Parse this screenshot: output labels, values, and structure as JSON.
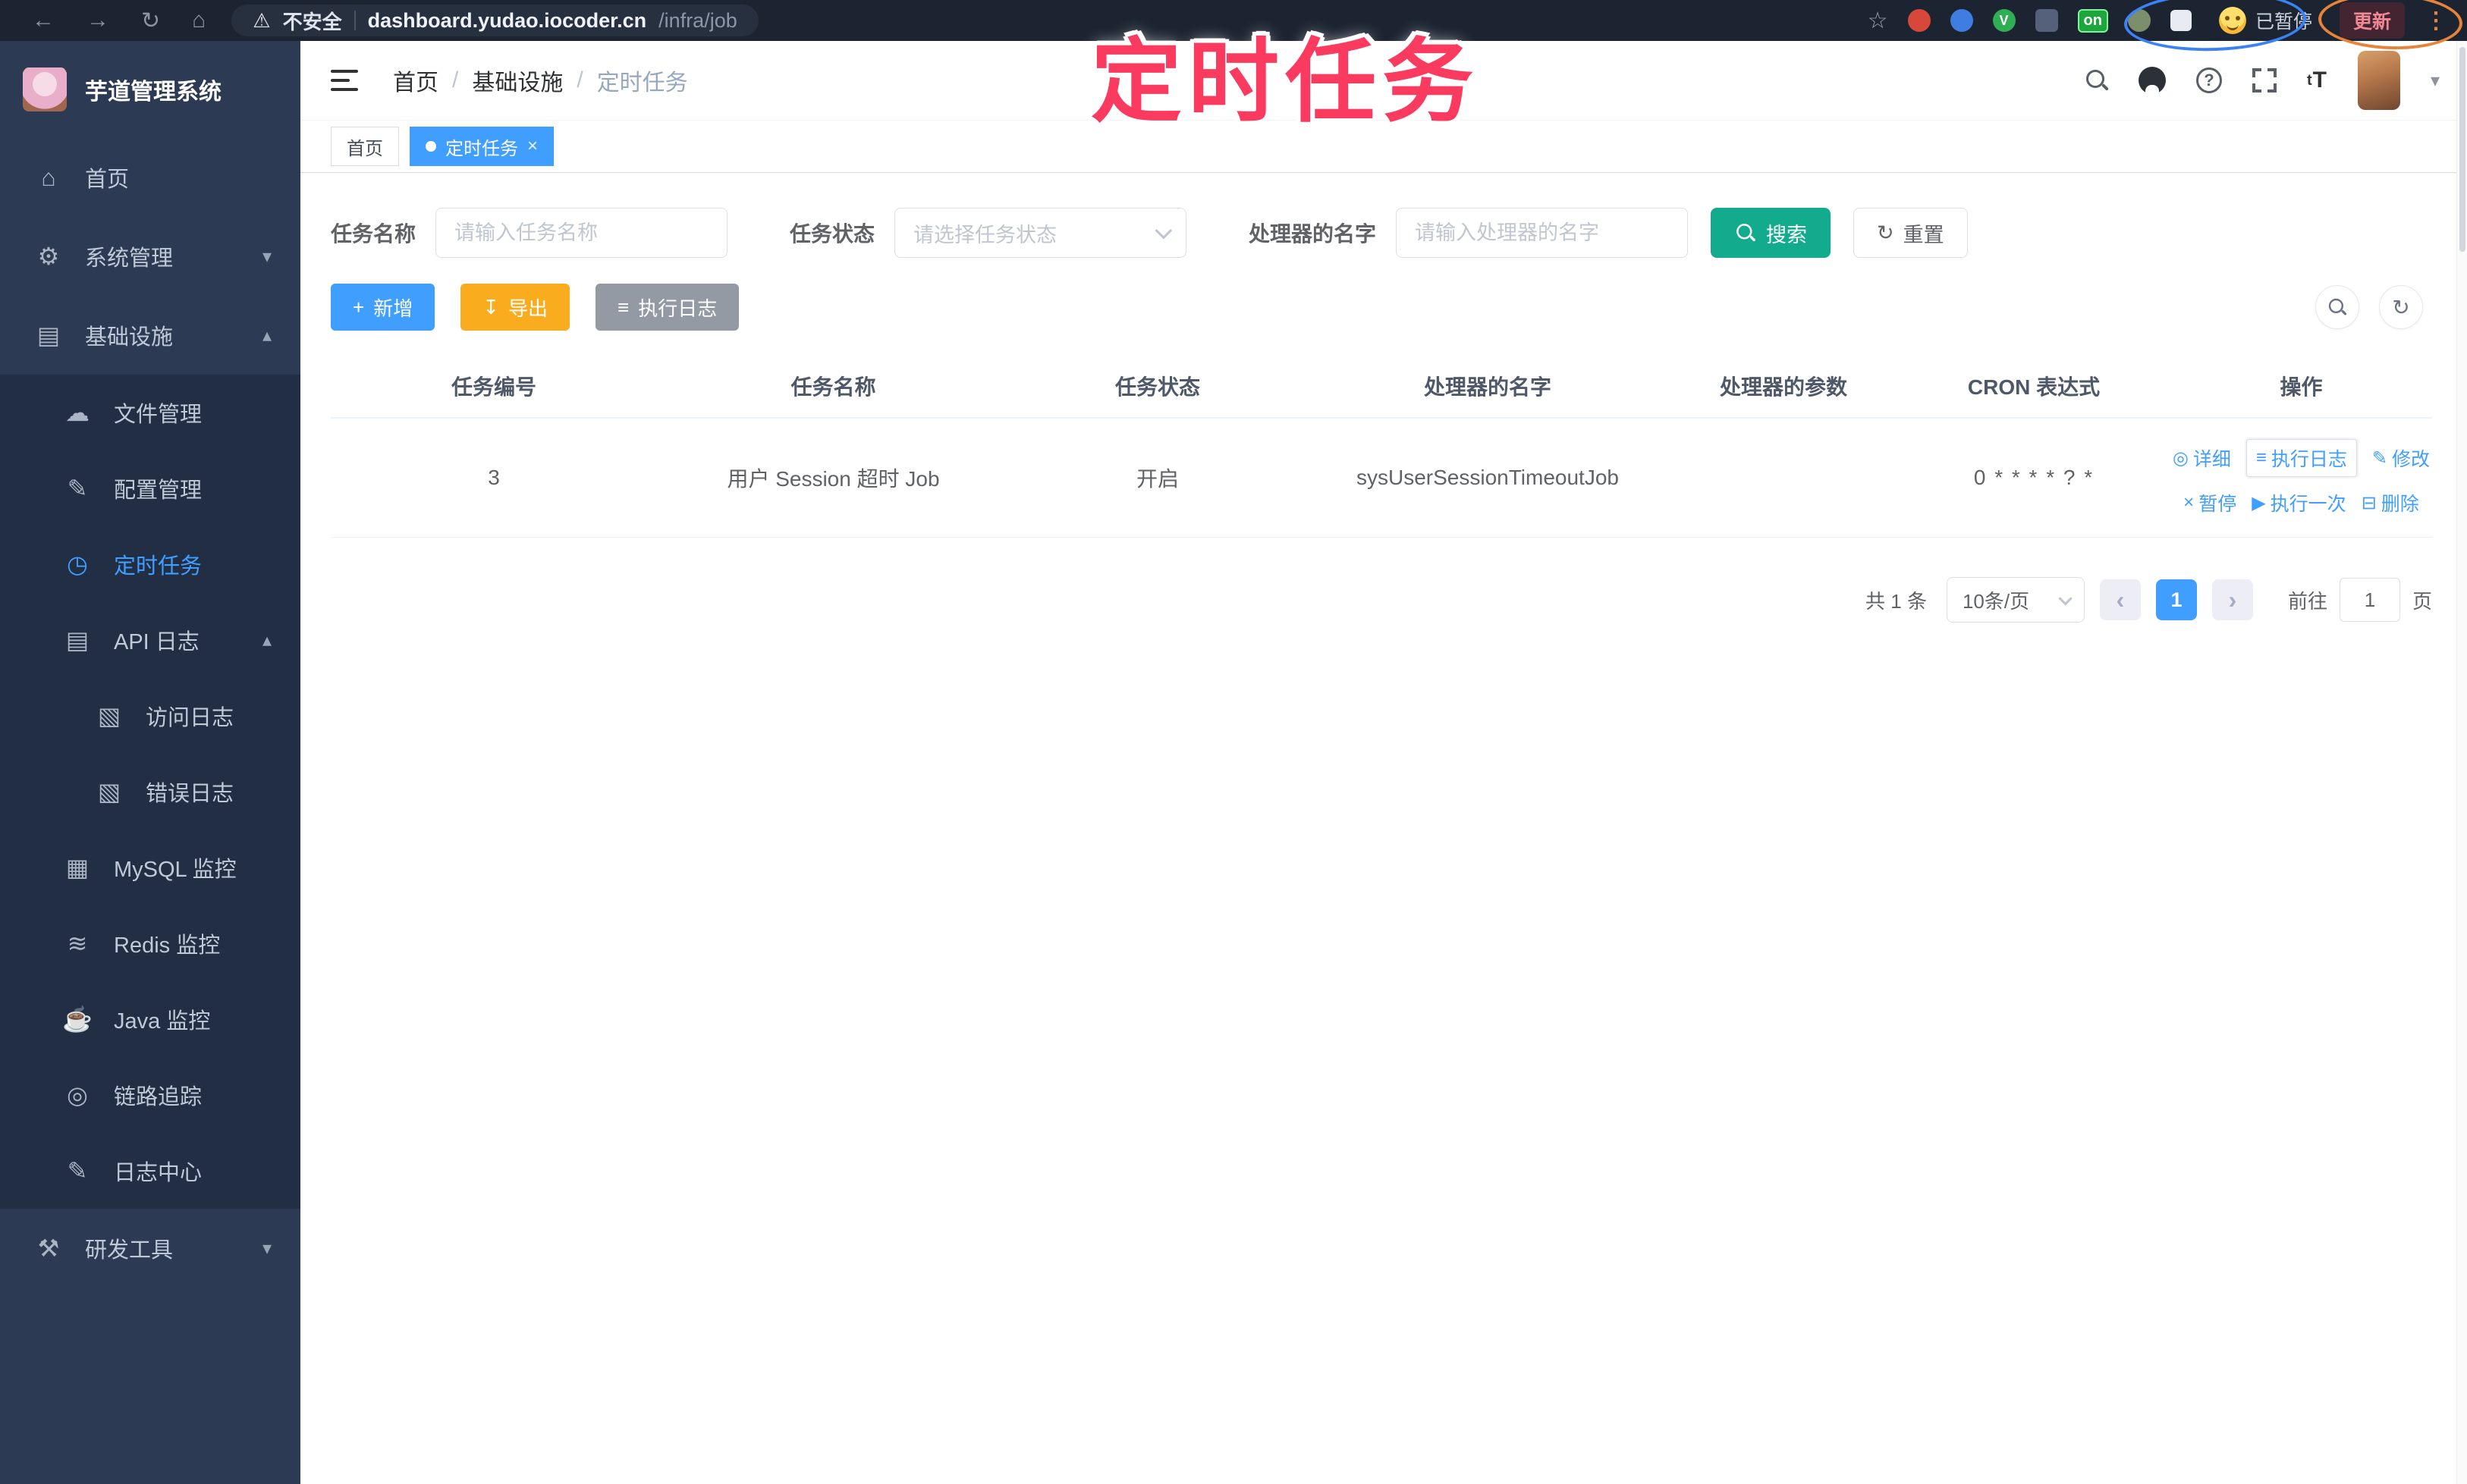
{
  "colors": {
    "primary": "#409EFF",
    "search_teal": "#12AB8D",
    "export_orange": "#F9AD1E",
    "info_gray": "#939AA3",
    "annotation_pink": "#FB3A5F",
    "sidebar_bg": "#2d3a53",
    "submenu_bg": "#222e43"
  },
  "annotation": {
    "text": "定时任务"
  },
  "browser": {
    "insecure_label": "不安全",
    "url_host": "dashboard.yudao.iocoder.cn",
    "url_path": "/infra/job",
    "ext_on_badge": "on",
    "paused_badge": "已暂停",
    "update_button": "更新"
  },
  "sidebar": {
    "title": "芋道管理系统",
    "items": [
      {
        "label": "首页",
        "icon": "home-icon",
        "level": 1
      },
      {
        "label": "系统管理",
        "icon": "gear-icon",
        "level": 1,
        "chevron": "down"
      },
      {
        "label": "基础设施",
        "icon": "infra-icon",
        "level": 1,
        "chevron": "up"
      },
      {
        "label": "文件管理",
        "icon": "cloud-upload-icon",
        "level": 2
      },
      {
        "label": "配置管理",
        "icon": "edit-icon",
        "level": 2
      },
      {
        "label": "定时任务",
        "icon": "schedule-icon",
        "level": 2,
        "active": true
      },
      {
        "label": "API 日志",
        "icon": "api-log-icon",
        "level": 2,
        "chevron": "up"
      },
      {
        "label": "访问日志",
        "icon": "access-log-icon",
        "level": 3
      },
      {
        "label": "错误日志",
        "icon": "error-log-icon",
        "level": 3
      },
      {
        "label": "MySQL 监控",
        "icon": "mysql-icon",
        "level": 2
      },
      {
        "label": "Redis 监控",
        "icon": "redis-icon",
        "level": 2
      },
      {
        "label": "Java 监控",
        "icon": "java-icon",
        "level": 2
      },
      {
        "label": "链路追踪",
        "icon": "trace-icon",
        "level": 2
      },
      {
        "label": "日志中心",
        "icon": "log-center-icon",
        "level": 2
      },
      {
        "label": "研发工具",
        "icon": "tools-icon",
        "level": 1,
        "chevron": "down"
      }
    ]
  },
  "icons": {
    "home-icon": "⌂",
    "gear-icon": "⚙",
    "infra-icon": "▤",
    "cloud-upload-icon": "☁",
    "edit-icon": "✎",
    "schedule-icon": "◷",
    "api-log-icon": "▤",
    "access-log-icon": "▧",
    "error-log-icon": "▧",
    "mysql-icon": "▦",
    "redis-icon": "≋",
    "java-icon": "☕",
    "trace-icon": "◎",
    "log-center-icon": "✎",
    "tools-icon": "⚒",
    "eye-icon": "◎",
    "loglines-icon": "≡",
    "close-icon": "×",
    "play-icon": "▶",
    "delete-icon": "⊟",
    "plus-icon": "+",
    "download-icon": "↧",
    "refresh-icon": "↻"
  },
  "breadcrumb": [
    "首页",
    "基础设施",
    "定时任务"
  ],
  "tags": [
    {
      "label": "首页",
      "active": false,
      "closable": false
    },
    {
      "label": "定时任务",
      "active": true,
      "closable": true
    }
  ],
  "filters": {
    "name_label": "任务名称",
    "name_placeholder": "请输入任务名称",
    "status_label": "任务状态",
    "status_placeholder": "请选择任务状态",
    "handler_label": "处理器的名字",
    "handler_placeholder": "请输入处理器的名字",
    "search_label": "搜索",
    "reset_label": "重置"
  },
  "toolbar": {
    "add_label": "新增",
    "export_label": "导出",
    "exec_log_label": "执行日志"
  },
  "table": {
    "headers": [
      "任务编号",
      "任务名称",
      "任务状态",
      "处理器的名字",
      "处理器的参数",
      "CRON 表达式",
      "操作"
    ],
    "rows": [
      {
        "id": "3",
        "name": "用户 Session 超时 Job",
        "status": "开启",
        "handler": "sysUserSessionTimeoutJob",
        "param": "",
        "cron": "0 * * * * ? *",
        "actions": [
          [
            {
              "icon": "eye-icon",
              "label": "详细"
            },
            {
              "icon": "loglines-icon",
              "label": "执行日志",
              "boxed": true
            },
            {
              "icon": "edit-icon",
              "label": "修改"
            }
          ],
          [
            {
              "icon": "close-icon",
              "label": "暂停"
            },
            {
              "icon": "play-icon",
              "label": "执行一次"
            },
            {
              "icon": "delete-icon",
              "label": "删除"
            }
          ]
        ]
      }
    ]
  },
  "pagination": {
    "total": "共 1 条",
    "page_size": "10条/页",
    "current_page": "1",
    "goto_label": "前往",
    "goto_value": "1",
    "page_unit": "页"
  }
}
